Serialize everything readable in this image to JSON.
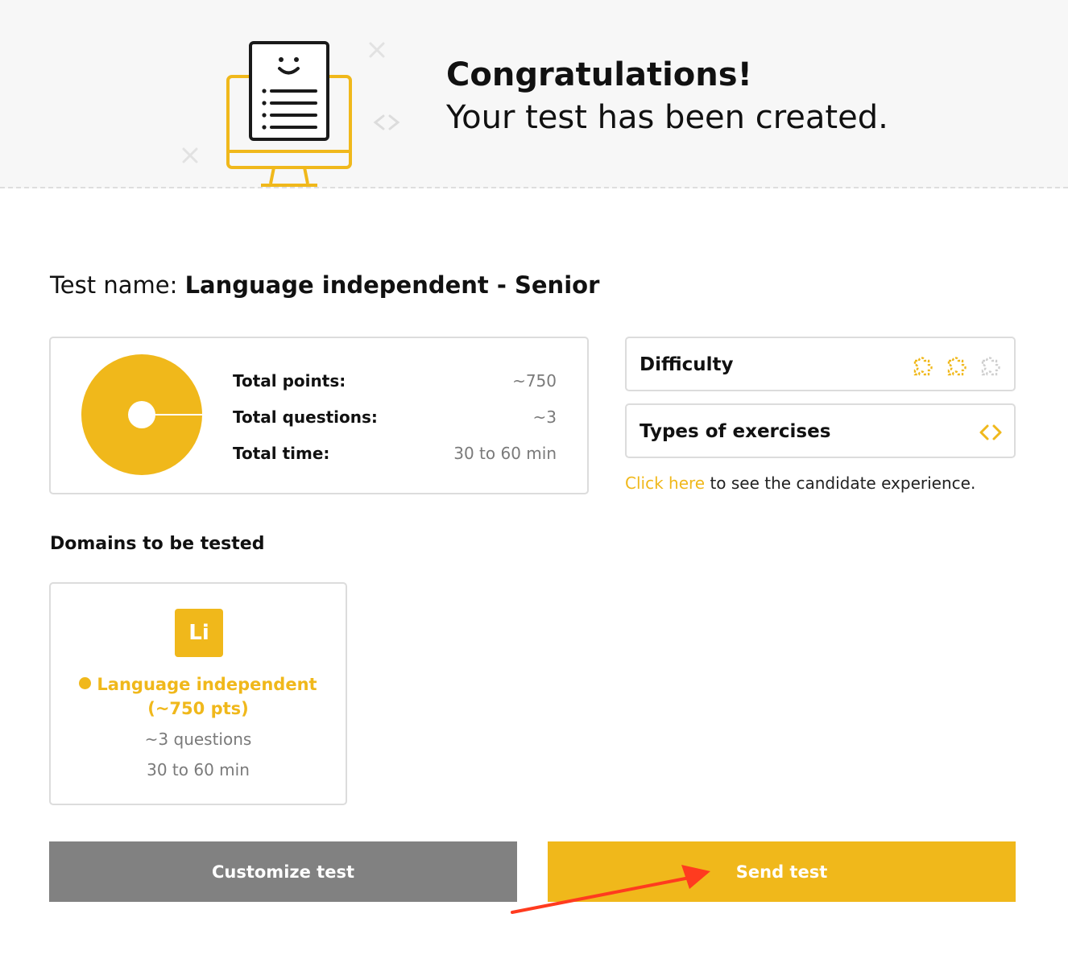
{
  "banner": {
    "heading": "Congratulations!",
    "subheading": "Your test has been created."
  },
  "test": {
    "name_label": "Test name: ",
    "name_value": "Language independent - Senior"
  },
  "summary": {
    "points_label": "Total points:",
    "points_value": "~750",
    "questions_label": "Total questions:",
    "questions_value": "~3",
    "time_label": "Total time:",
    "time_value": "30 to 60 min"
  },
  "difficulty": {
    "title": "Difficulty",
    "level": 2,
    "max_level": 3
  },
  "exercises": {
    "title": "Types of exercises"
  },
  "candidate": {
    "link_text": "Click here",
    "rest_text": " to see the candidate experience."
  },
  "domains": {
    "heading": "Domains to be tested",
    "items": [
      {
        "badge": "Li",
        "name": "Language independent",
        "points": "(~750 pts)",
        "questions": "~3 questions",
        "time": "30 to 60 min"
      }
    ]
  },
  "buttons": {
    "customize": "Customize test",
    "send": "Send test"
  },
  "colors": {
    "accent": "#f0b81b",
    "gray_button": "#818181",
    "arrow": "#ff3b1f"
  },
  "icons": {
    "banner": "monitor-document-smiley-icon",
    "difficulty": "puzzle-icon",
    "exercises": "code-brackets-icon"
  }
}
